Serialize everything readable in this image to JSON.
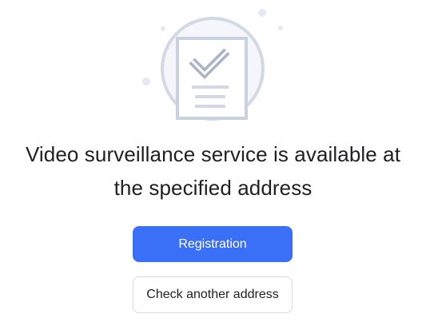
{
  "result": {
    "title_line1": "Video surveillance service is available at",
    "title_line2": "the specified address",
    "illustration_icon": "document-check-icon"
  },
  "actions": {
    "primary_label": "Registration",
    "secondary_label": "Check another address"
  },
  "colors": {
    "primary": "#3a6ff8",
    "illustration_stroke": "#c9d0e0",
    "illustration_fill": "#f4f6fb",
    "text": "#1f1f24"
  }
}
